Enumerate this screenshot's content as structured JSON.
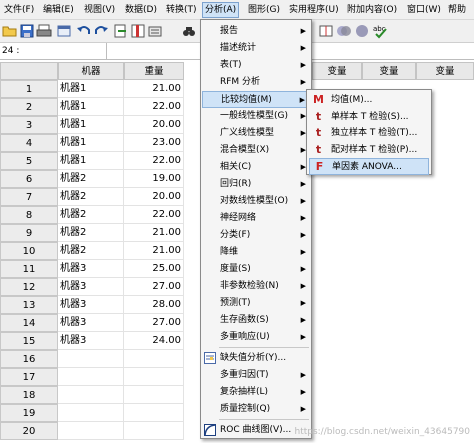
{
  "menubar": {
    "items": [
      {
        "label": "文件(F)"
      },
      {
        "label": "编辑(E)"
      },
      {
        "label": "视图(V)"
      },
      {
        "label": "数据(D)"
      },
      {
        "label": "转换(T)"
      },
      {
        "label": "分析(A)"
      },
      {
        "label": "图形(G)"
      },
      {
        "label": "实用程序(U)"
      },
      {
        "label": "附加内容(O)"
      },
      {
        "label": "窗口(W)"
      },
      {
        "label": "帮助"
      }
    ]
  },
  "refbar": {
    "cell_ref": "24 :"
  },
  "grid": {
    "columns": [
      "机器",
      "重量",
      "变量",
      "变量",
      "变量"
    ],
    "rows": [
      {
        "num": "1",
        "machine": "机器1",
        "weight": "21.00"
      },
      {
        "num": "2",
        "machine": "机器1",
        "weight": "22.00"
      },
      {
        "num": "3",
        "machine": "机器1",
        "weight": "20.00"
      },
      {
        "num": "4",
        "machine": "机器1",
        "weight": "23.00"
      },
      {
        "num": "5",
        "machine": "机器1",
        "weight": "22.00"
      },
      {
        "num": "6",
        "machine": "机器2",
        "weight": "19.00"
      },
      {
        "num": "7",
        "machine": "机器2",
        "weight": "20.00"
      },
      {
        "num": "8",
        "machine": "机器2",
        "weight": "22.00"
      },
      {
        "num": "9",
        "machine": "机器2",
        "weight": "21.00"
      },
      {
        "num": "10",
        "machine": "机器2",
        "weight": "21.00"
      },
      {
        "num": "11",
        "machine": "机器3",
        "weight": "25.00"
      },
      {
        "num": "12",
        "machine": "机器3",
        "weight": "27.00"
      },
      {
        "num": "13",
        "machine": "机器3",
        "weight": "28.00"
      },
      {
        "num": "14",
        "machine": "机器3",
        "weight": "27.00"
      },
      {
        "num": "15",
        "machine": "机器3",
        "weight": "24.00"
      },
      {
        "num": "16",
        "machine": "",
        "weight": ""
      },
      {
        "num": "17",
        "machine": "",
        "weight": ""
      },
      {
        "num": "18",
        "machine": "",
        "weight": ""
      },
      {
        "num": "19",
        "machine": "",
        "weight": ""
      },
      {
        "num": "20",
        "machine": "",
        "weight": ""
      }
    ]
  },
  "analyze_menu": {
    "items": [
      {
        "label": "报告"
      },
      {
        "label": "描述统计"
      },
      {
        "label": "表(T)"
      },
      {
        "label": "RFM 分析"
      },
      {
        "label": "比较均值(M)"
      },
      {
        "label": "一般线性模型(G)"
      },
      {
        "label": "广义线性模型"
      },
      {
        "label": "混合模型(X)"
      },
      {
        "label": "相关(C)"
      },
      {
        "label": "回归(R)"
      },
      {
        "label": "对数线性模型(O)"
      },
      {
        "label": "神经网络"
      },
      {
        "label": "分类(F)"
      },
      {
        "label": "降维"
      },
      {
        "label": "度量(S)"
      },
      {
        "label": "非参数检验(N)"
      },
      {
        "label": "预测(T)"
      },
      {
        "label": "生存函数(S)"
      },
      {
        "label": "多重响应(U)"
      },
      {
        "label": "缺失值分析(Y)..."
      },
      {
        "label": "多重归因(T)"
      },
      {
        "label": "复杂抽样(L)"
      },
      {
        "label": "质量控制(Q)"
      },
      {
        "label": "ROC 曲线图(V)..."
      }
    ]
  },
  "compare_means_submenu": {
    "items": [
      {
        "label": "均值(M)...",
        "icon_char": "M",
        "icon_color": "#cc2222"
      },
      {
        "label": "单样本 T 检验(S)...",
        "icon_char": "t",
        "icon_color": "#aa2222"
      },
      {
        "label": "独立样本 T 检验(T)...",
        "icon_char": "t",
        "icon_color": "#aa2222"
      },
      {
        "label": "配对样本 T 检验(P)...",
        "icon_char": "t",
        "icon_color": "#aa2222"
      },
      {
        "label": "单因素 ANOVA...",
        "icon_char": "F",
        "icon_color": "#cc2222"
      }
    ]
  },
  "watermark": "https://blog.csdn.net/weixin_43645790"
}
